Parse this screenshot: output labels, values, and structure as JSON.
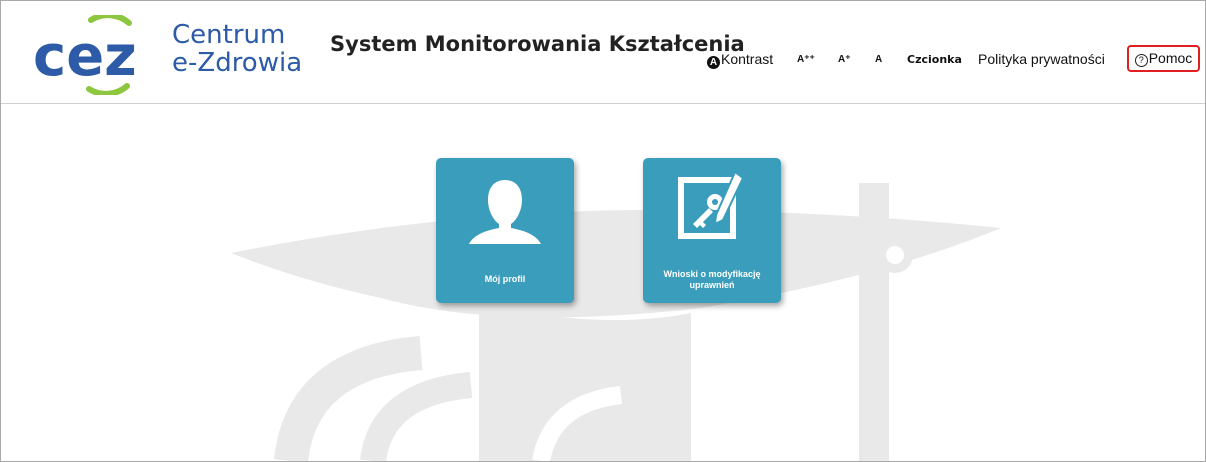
{
  "logo": {
    "mark": "cez",
    "line1": "Centrum",
    "line2": "e-Zdrowia"
  },
  "app_title": "System Monitorowania Kształcenia",
  "toolbar": {
    "contrast_label": "Kontrast",
    "contrast_icon": "contrast-icon",
    "font_large": "A⁺⁺",
    "font_medium": "A⁺",
    "font_normal": "A",
    "font_label": "Czcionka",
    "privacy": "Polityka prywatności",
    "help_label": "Pomoc",
    "help_icon": "question-circle-icon"
  },
  "tiles": [
    {
      "label": "Mój profil",
      "icon": "user-profile-icon"
    },
    {
      "label": "Wnioski o modyfikację uprawnień",
      "icon": "key-pen-icon"
    }
  ],
  "colors": {
    "brand_blue": "#2d5ba7",
    "brand_green": "#8dc63f",
    "tile": "#3a9dbc",
    "help_border": "#e02020",
    "watermark": "#e9e9e9"
  }
}
